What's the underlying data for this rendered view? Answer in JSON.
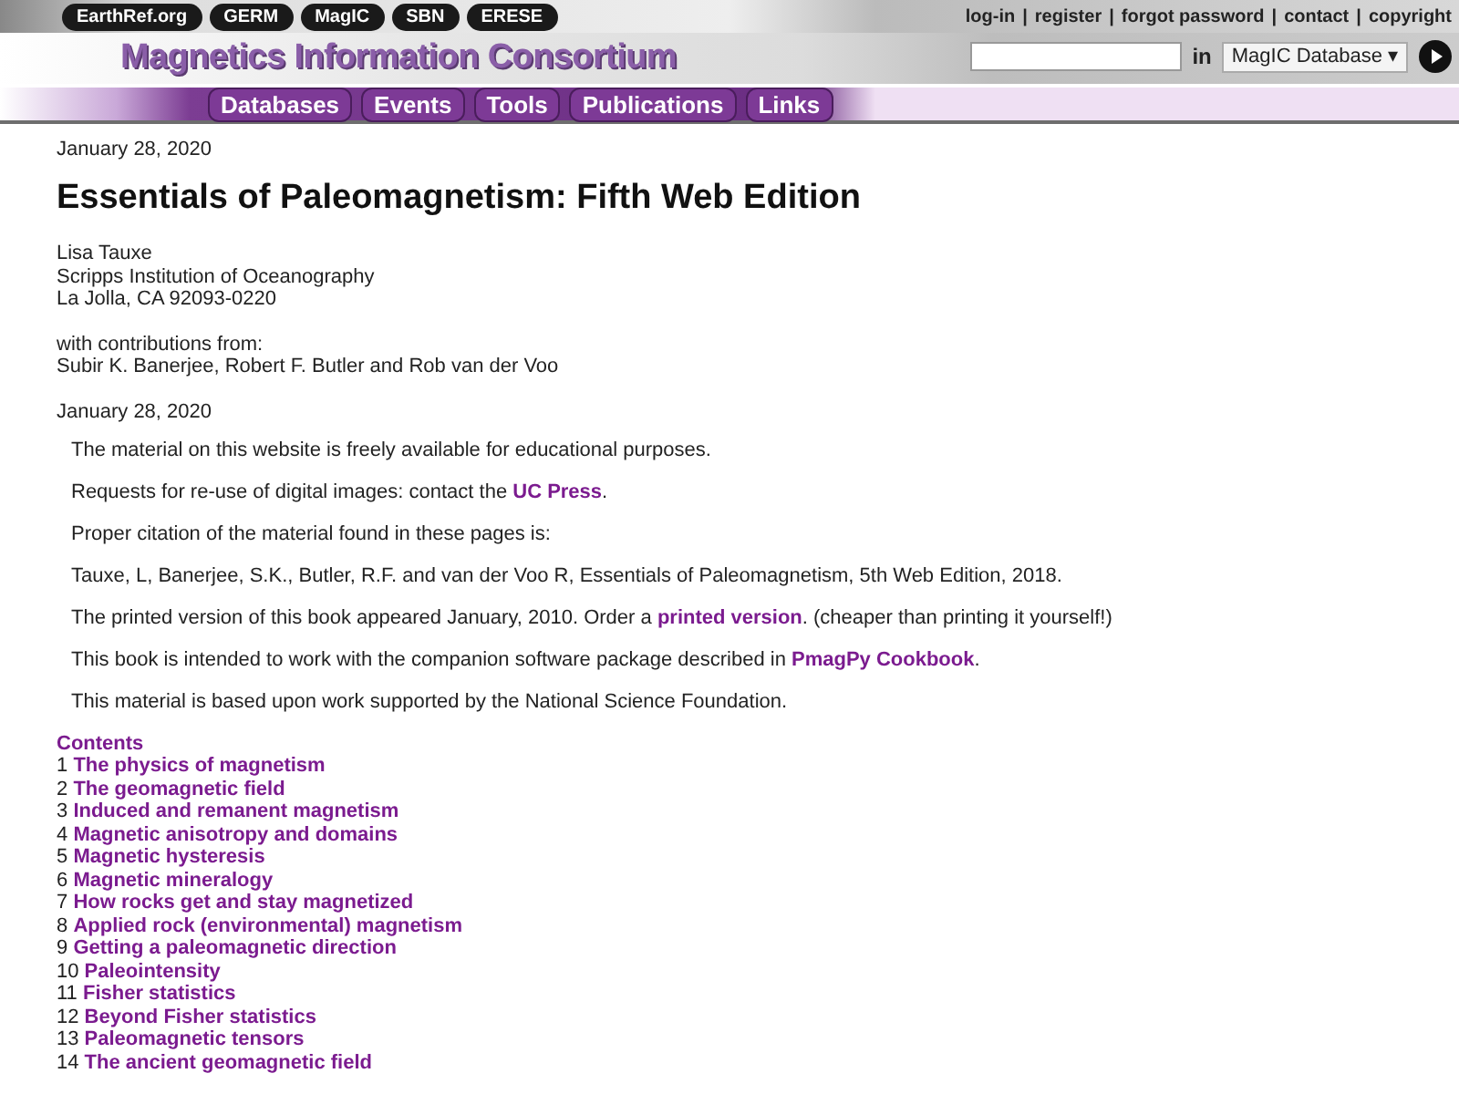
{
  "header": {
    "site_links": [
      "EarthRef.org",
      "GERM",
      "MagIC",
      "SBN",
      "ERESE"
    ],
    "title": "Magnetics Information Consortium",
    "nav": [
      "Databases",
      "Events",
      "Tools",
      "Publications",
      "Links"
    ],
    "account_links": [
      "log-in",
      "register",
      "forgot password",
      "contact",
      "copyright"
    ],
    "account_separator": "|",
    "search": {
      "in_label": "in",
      "scope": "MagIC Database ▾"
    }
  },
  "date": "January 28, 2020",
  "heading": "Essentials of Paleomagnetism: Fifth Web Edition",
  "author": [
    "Lisa Tauxe",
    "Scripps Institution of Oceanography",
    "La Jolla, CA 92093-0220"
  ],
  "contributors": [
    "with contributions from:",
    "Subir K. Banerjee, Robert F. Butler and Rob van der Voo"
  ],
  "date_2": "January 28, 2020",
  "paragraphs": [
    [
      {
        "text": "The material on this website is freely available for educational purposes."
      }
    ],
    [
      {
        "text": "Requests for re-use of digital images: contact the "
      },
      {
        "link": "UC Press"
      },
      {
        "text": "."
      }
    ],
    [
      {
        "text": "Proper citation of the material found in these pages is:"
      }
    ],
    [
      {
        "text": "Tauxe, L, Banerjee, S.K., Butler, R.F. and van der Voo R, Essentials of Paleomagnetism, 5th Web Edition, 2018."
      }
    ],
    [
      {
        "text": "The printed version of this book appeared January, 2010. Order a "
      },
      {
        "link": "printed version"
      },
      {
        "text": ". (cheaper than printing it yourself!)"
      }
    ],
    [
      {
        "text": "This book is intended to work with the companion software package described in "
      },
      {
        "link": "PmagPy Cookbook"
      },
      {
        "text": "."
      }
    ],
    [
      {
        "text": "This material is based upon work supported by the National Science Foundation."
      }
    ]
  ],
  "contents": {
    "title": "Contents",
    "chapters": [
      {
        "number": "1",
        "title": "The physics of magnetism"
      },
      {
        "number": "2",
        "title": "The geomagnetic field"
      },
      {
        "number": "3",
        "title": "Induced and remanent magnetism"
      },
      {
        "number": "4",
        "title": "Magnetic anisotropy and domains"
      },
      {
        "number": "5",
        "title": "Magnetic hysteresis"
      },
      {
        "number": "6",
        "title": "Magnetic mineralogy"
      },
      {
        "number": "7",
        "title": "How rocks get and stay magnetized"
      },
      {
        "number": "8",
        "title": "Applied rock (environmental) magnetism"
      },
      {
        "number": "9",
        "title": "Getting a paleomagnetic direction"
      },
      {
        "number": "10",
        "title": "Paleointensity"
      },
      {
        "number": "11",
        "title": "Fisher statistics"
      },
      {
        "number": "12",
        "title": "Beyond Fisher statistics"
      },
      {
        "number": "13",
        "title": "Paleomagnetic tensors"
      },
      {
        "number": "14",
        "title": "The ancient geomagnetic field"
      }
    ]
  }
}
